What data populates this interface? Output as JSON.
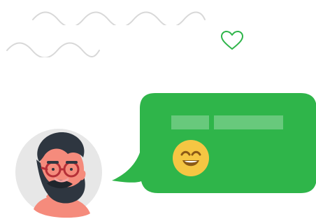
{
  "colors": {
    "primary_green": "#2fb54a",
    "outline_green": "#2fb54a",
    "wave_gray": "#d8d8d8",
    "avatar_bg": "#e7e7e7",
    "skin": "#f58b7c",
    "hair": "#2e3640",
    "glasses": "#b52f37",
    "emoji_yellow": "#f5c643"
  },
  "icons": {
    "heart": "heart-outline-icon",
    "smile": "smile-emoji-icon"
  },
  "avatar": {
    "type": "bearded-man"
  }
}
